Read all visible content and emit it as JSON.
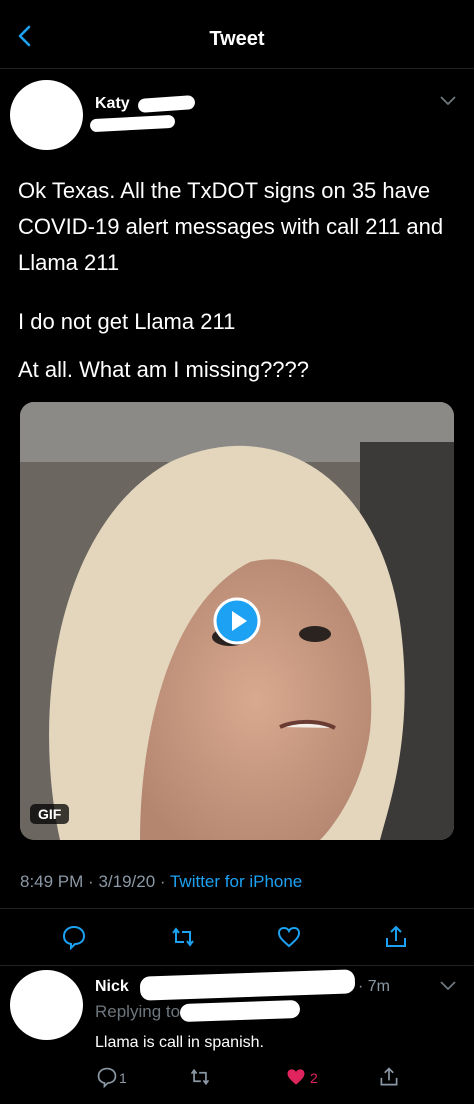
{
  "header": {
    "title": "Tweet"
  },
  "tweet": {
    "author_name": "Katy",
    "paragraphs": [
      "Ok Texas. All the TxDOT signs on 35 have COVID-19 alert messages with call 211 and Llama 211",
      "I do not get Llama 211",
      "At all. What am I missing????"
    ],
    "media_badge": "GIF",
    "time": "8:49 PM",
    "date": "3/19/20",
    "source": "Twitter for iPhone"
  },
  "reply": {
    "author_name": "Nick",
    "time": "7m",
    "replying_prefix": "Replying to",
    "text": "Llama is call in spanish.",
    "reply_count": "1",
    "like_count": "2",
    "like_color": "#e0245e"
  },
  "colors": {
    "accent": "#1da1f2",
    "muted": "#8b98a5",
    "background": "#000000"
  },
  "icons": [
    "back-chevron-icon",
    "play-icon",
    "reply-icon",
    "retweet-icon",
    "like-icon",
    "share-icon",
    "chevron-down-icon"
  ]
}
